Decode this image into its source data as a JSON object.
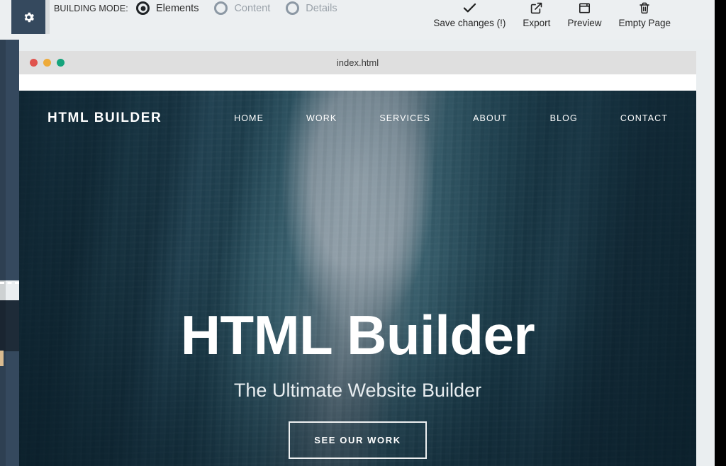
{
  "toolbar": {
    "gear_icon": "gear-icon",
    "mode_label": "BUILDING MODE:",
    "modes": [
      {
        "label": "Elements",
        "selected": true
      },
      {
        "label": "Content",
        "selected": false
      },
      {
        "label": "Details",
        "selected": false
      }
    ],
    "actions": [
      {
        "label": "Save changes (!)",
        "icon": "check-icon"
      },
      {
        "label": "Export",
        "icon": "external-link-icon"
      },
      {
        "label": "Preview",
        "icon": "window-icon"
      },
      {
        "label": "Empty Page",
        "icon": "trash-icon"
      }
    ]
  },
  "browser": {
    "title": "index.html",
    "dots": [
      {
        "name": "close-dot",
        "color": "#e0544e"
      },
      {
        "name": "minimize-dot",
        "color": "#eeab3a"
      },
      {
        "name": "maximize-dot",
        "color": "#16a47c"
      }
    ]
  },
  "site": {
    "brand": "HTML BUILDER",
    "nav": [
      "HOME",
      "WORK",
      "SERVICES",
      "ABOUT",
      "BLOG",
      "CONTACT"
    ],
    "hero": {
      "title": "HTML Builder",
      "subtitle": "The Ultimate Website Builder",
      "cta": "SEE OUR WORK"
    }
  },
  "colors": {
    "sidebar": "#35495e",
    "sidebar_dark": "#1e2b38",
    "toolbar_bg": "#eceff1",
    "chrome_bg": "#dfdfdf",
    "accent_tan": "#d9bb90"
  }
}
